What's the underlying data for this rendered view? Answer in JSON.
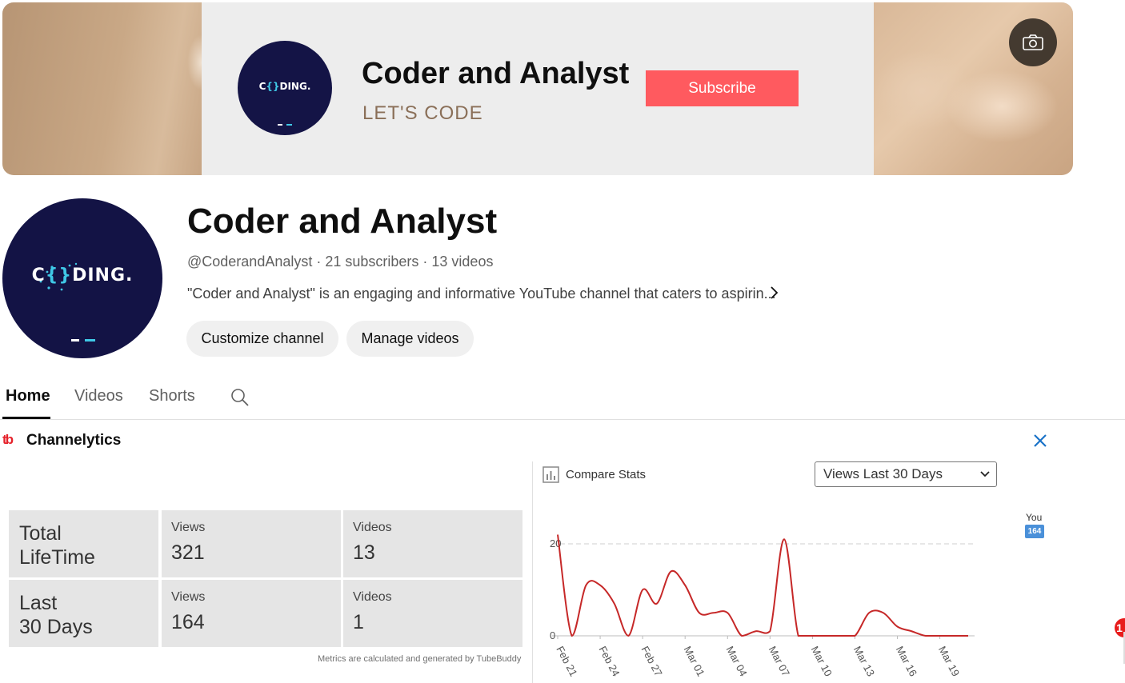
{
  "banner": {
    "title": "Coder and Analyst",
    "tagline": "LET'S CODE",
    "subscribe_label": "Subscribe",
    "logo_text_pre": "C",
    "logo_text_brackets": "{}",
    "logo_text_post": "DING.",
    "camera_icon": "camera-icon"
  },
  "channel": {
    "name": "Coder and Analyst",
    "meta": "@CoderandAnalyst · 21 subscribers · 13 videos",
    "description": "\"Coder and Analyst\" is an engaging and informative YouTube channel that caters to aspirin...",
    "logo_text_pre": "C",
    "logo_text_brackets": "{}",
    "logo_text_post": "DING.",
    "customize_label": "Customize channel",
    "manage_label": "Manage videos"
  },
  "tabs": [
    {
      "label": "Home",
      "active": true
    },
    {
      "label": "Videos",
      "active": false
    },
    {
      "label": "Shorts",
      "active": false
    }
  ],
  "channelytics": {
    "logo": "tb",
    "title": "Channelytics",
    "rows": [
      {
        "label_line1": "Total",
        "label_line2": "LifeTime",
        "views_label": "Views",
        "views_value": "321",
        "videos_label": "Videos",
        "videos_value": "13"
      },
      {
        "label_line1": "Last",
        "label_line2": "30 Days",
        "views_label": "Views",
        "views_value": "164",
        "videos_label": "Videos",
        "videos_value": "1"
      }
    ],
    "metrics_note": "Metrics are calculated and generated by TubeBuddy",
    "compare_label": "Compare Stats",
    "select_value": "Views Last 30 Days",
    "legend_you": "You",
    "legend_value": "164",
    "notification_count": "1"
  },
  "chart_data": {
    "type": "line",
    "x": [
      "Feb 21",
      "Feb 22",
      "Feb 23",
      "Feb 24",
      "Feb 25",
      "Feb 26",
      "Feb 27",
      "Feb 28",
      "Feb 29",
      "Mar 01",
      "Mar 02",
      "Mar 03",
      "Mar 04",
      "Mar 05",
      "Mar 06",
      "Mar 07",
      "Mar 08",
      "Mar 09",
      "Mar 10",
      "Mar 11",
      "Mar 12",
      "Mar 13",
      "Mar 14",
      "Mar 15",
      "Mar 16",
      "Mar 17",
      "Mar 18",
      "Mar 19",
      "Mar 20",
      "Mar 21"
    ],
    "tick_labels": [
      "Feb 21",
      "Feb 24",
      "Feb 27",
      "Mar 01",
      "Mar 04",
      "Mar 07",
      "Mar 10",
      "Mar 13",
      "Mar 16",
      "Mar 19"
    ],
    "series": [
      {
        "name": "You",
        "values": [
          22,
          0,
          11,
          11,
          7,
          0,
          10,
          7,
          14,
          11,
          5,
          5,
          5,
          0,
          1,
          1,
          21,
          0,
          0,
          0,
          0,
          0,
          5,
          5,
          2,
          1,
          0,
          0,
          0,
          0
        ],
        "color": "#c62828"
      }
    ],
    "yticks": [
      0,
      20
    ],
    "ylim": [
      0,
      22
    ],
    "grid": true,
    "legend": "top-right"
  }
}
